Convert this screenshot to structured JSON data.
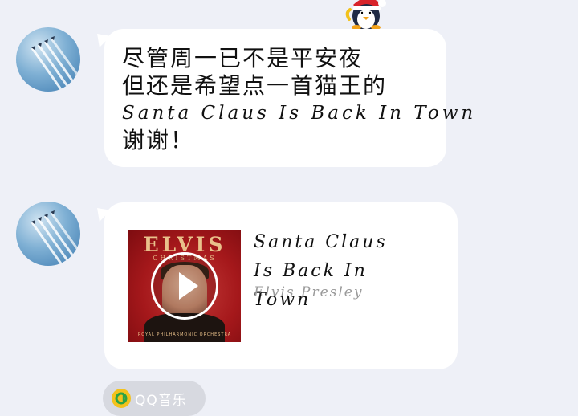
{
  "messages": [
    {
      "type": "text",
      "lines": [
        "尽管周一已不是平安夜",
        "但还是希望点一首猫王的",
        "Santa Claus Is Back In Town",
        "谢谢！"
      ]
    },
    {
      "type": "music-card",
      "album": {
        "title": "ELVIS",
        "subtitle": "CHRISTMAS",
        "footer": "ROYAL PHILHARMONIC ORCHESTRA"
      },
      "song_title": "Santa Claus Is Back In Town",
      "artist": "Elvis Presley"
    }
  ],
  "source_badge": {
    "label": "QQ音乐"
  },
  "colors": {
    "background": "#eef0f7",
    "bubble": "#ffffff",
    "album_red": "#a5181b",
    "artist_gray": "#9a9a9a",
    "badge_bg": "#d7d9e0",
    "badge_icon": "#f3c21c"
  },
  "icons": {
    "sticker": "penguin-santa-icon",
    "play": "play-icon",
    "source": "qq-music-icon"
  }
}
